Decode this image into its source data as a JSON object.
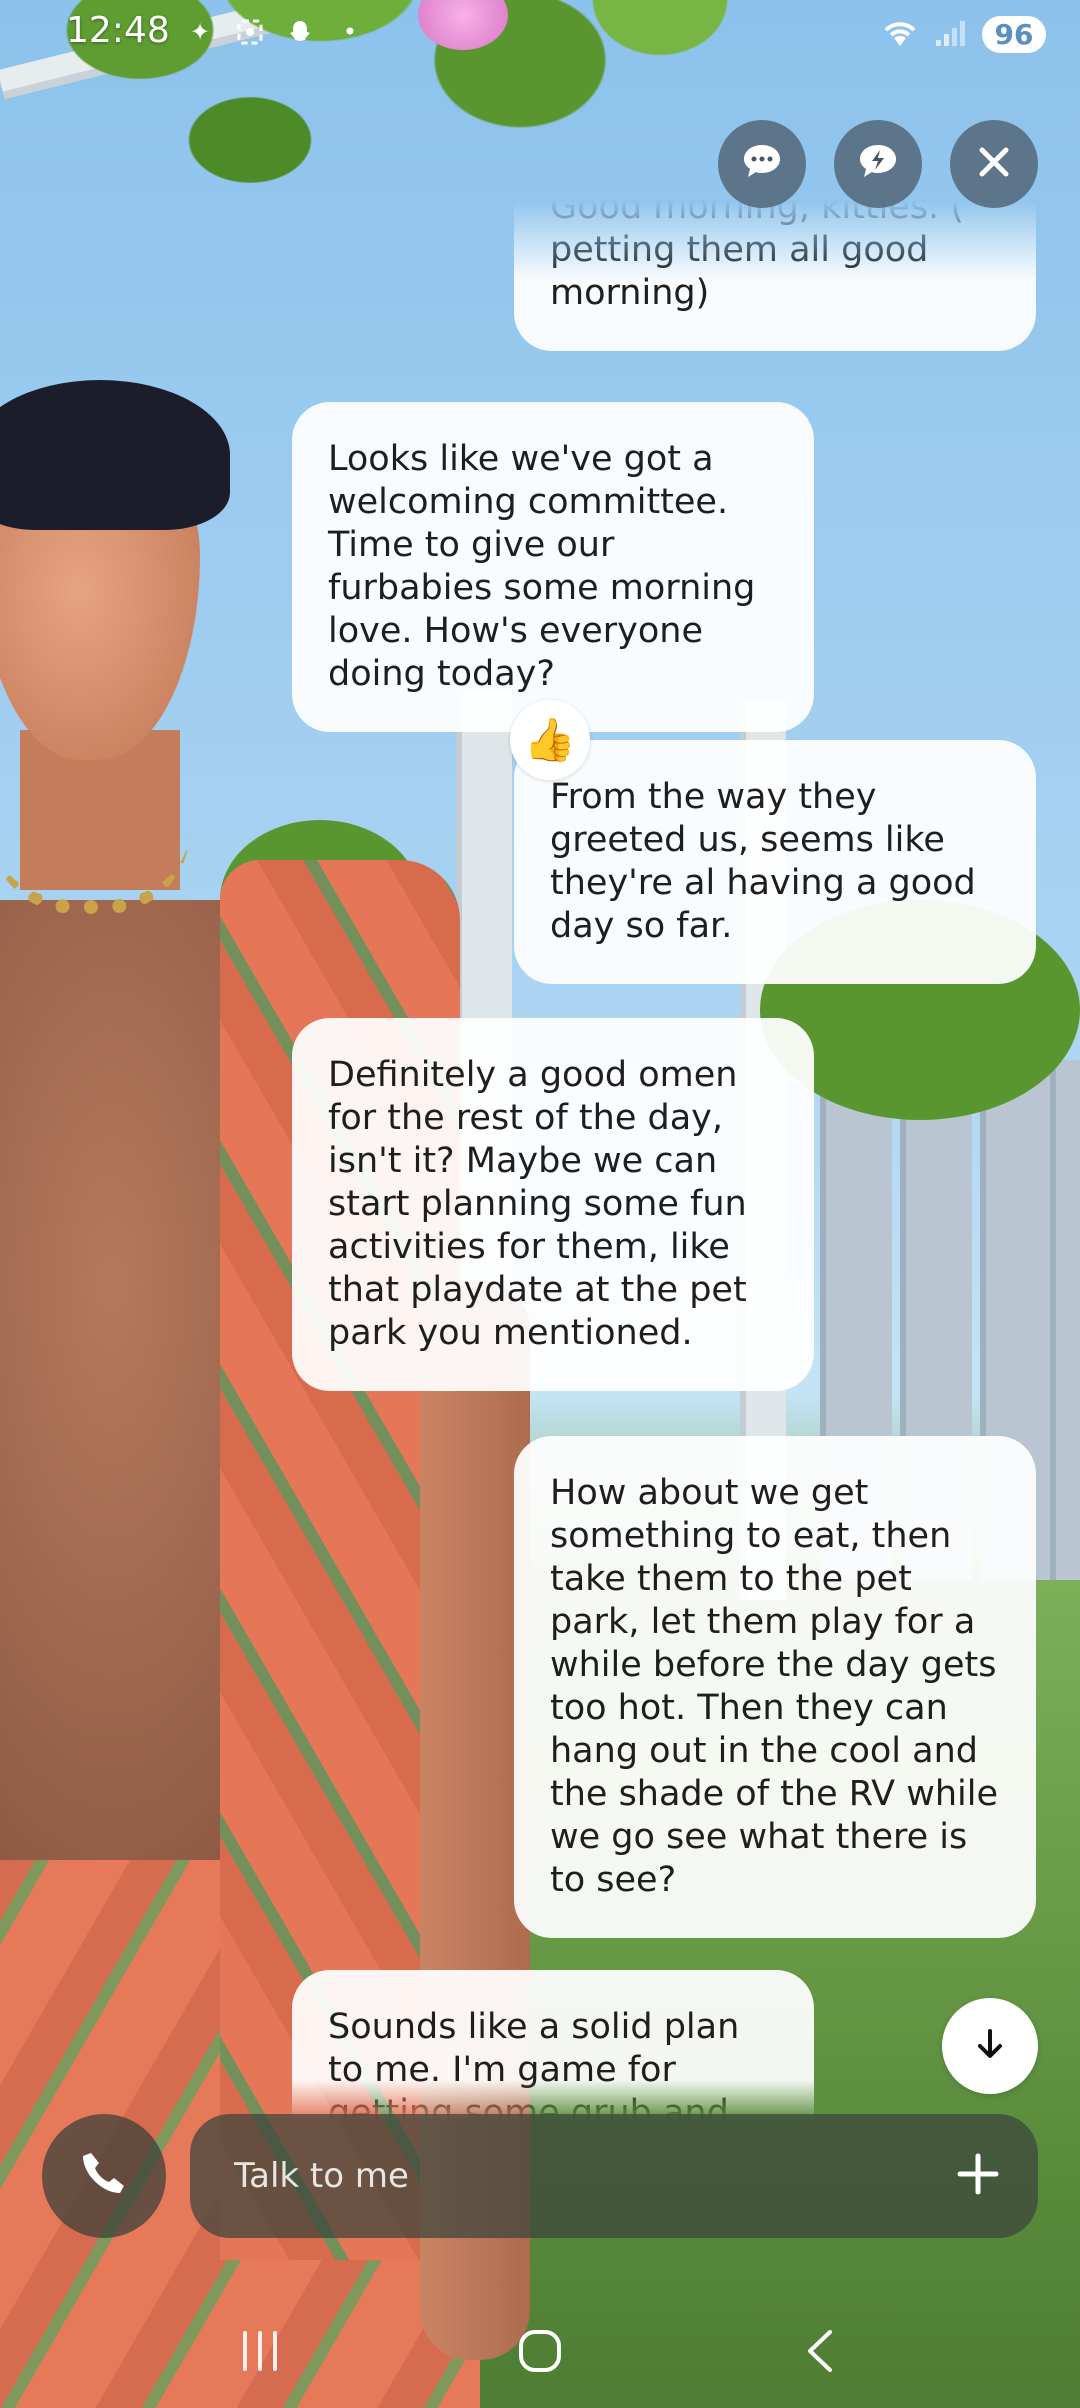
{
  "status_bar": {
    "time": "12:48",
    "battery": "96"
  },
  "top_actions": {
    "chat_icon": "chat-bubble-icon",
    "quick_reply_icon": "lightning-bubble-icon",
    "close_icon": "close-icon"
  },
  "messages": [
    {
      "side": "right",
      "text": "Good morning, kitties. ( petting them all good morning)"
    },
    {
      "side": "left",
      "text": "Looks like we've got a welcoming committee. Time to give our furbabies some morning love. How's everyone doing today?"
    },
    {
      "side": "right",
      "text": "From the way they greeted us, seems like they're al having a good day so far.",
      "reaction": "👍"
    },
    {
      "side": "left",
      "text": "Definitely a good omen for the rest of the day, isn't it? Maybe we can start planning some fun activities for them, like that playdate at the pet park you mentioned."
    },
    {
      "side": "right",
      "text": "How about we get something to eat, then take them to the pet park, let them play for a while before the day gets too hot.  Then they can hang out in the cool and the shade of the RV while we go see what there is to see?"
    },
    {
      "side": "left",
      "text": "Sounds like a solid plan to me. I'm game for getting some grub and letting the"
    }
  ],
  "input": {
    "placeholder": "Talk to me",
    "value": ""
  },
  "colors": {
    "bubble": "#ffffff",
    "control_bg": "#485664",
    "input_bg": "#3c443c"
  }
}
